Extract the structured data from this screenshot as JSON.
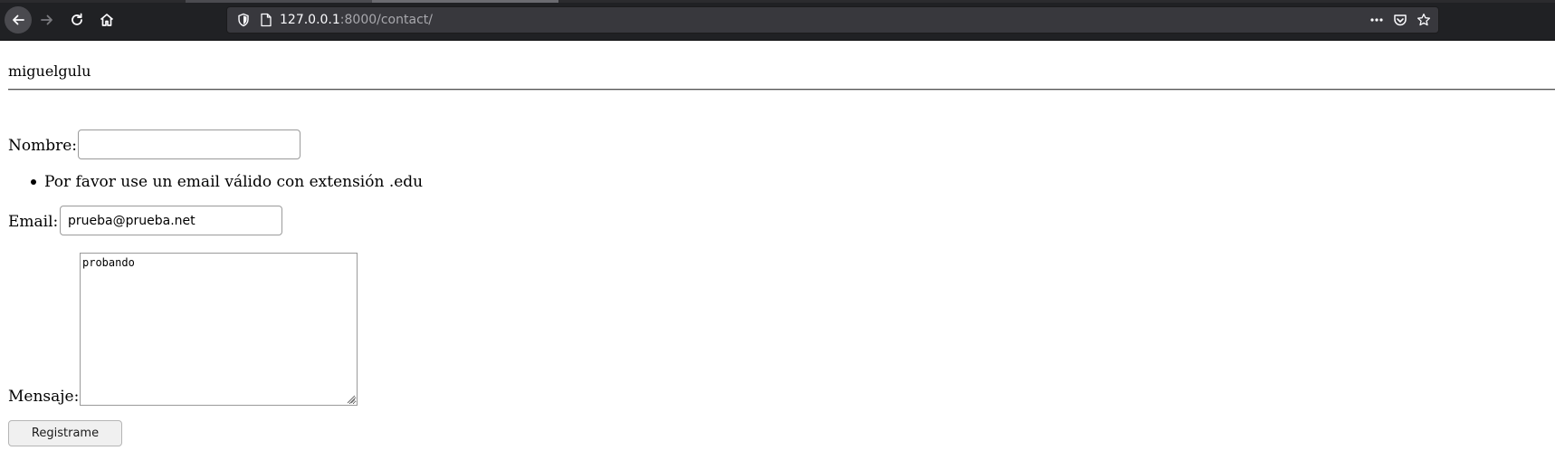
{
  "browser": {
    "url_host": "127.0.0.1",
    "url_rest": ":8000/contact/",
    "nav_icons": [
      "back-icon",
      "forward-icon",
      "reload-icon",
      "home-icon"
    ],
    "urlbar_icons": [
      "tracking-shield-icon",
      "page-info-icon",
      "more-actions-icon",
      "pocket-icon",
      "bookmark-star-icon"
    ],
    "colors": {
      "chrome_bg": "#202124",
      "urlbar_bg": "#38383d",
      "url_host": "#fbfbfe",
      "url_rest": "#a8a8ad"
    }
  },
  "page": {
    "user": "miguelgulu",
    "form": {
      "nombre_label": "Nombre:",
      "nombre_value": "",
      "email_error": "Por favor use un email válido con extensión .edu",
      "email_label": "Email:",
      "email_value": "prueba@prueba.net",
      "mensaje_label": "Mensaje:",
      "mensaje_value": "probando",
      "submit_label": "Registrame"
    }
  }
}
